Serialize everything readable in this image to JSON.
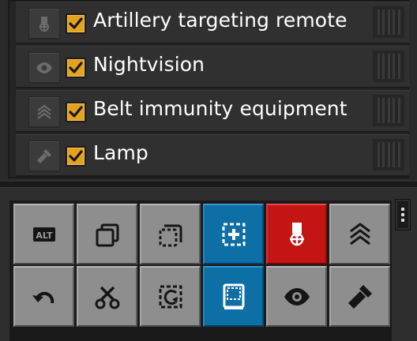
{
  "equipment_list": [
    {
      "label": "Artillery targeting remote",
      "icon": "artillery-remote-icon",
      "checked": true
    },
    {
      "label": "Nightvision",
      "icon": "eye-icon",
      "checked": true
    },
    {
      "label": "Belt immunity equipment",
      "icon": "belt-immunity-icon",
      "checked": true
    },
    {
      "label": "Lamp",
      "icon": "flashlight-icon",
      "checked": true
    }
  ],
  "toolbar": {
    "row1": [
      {
        "icon": "alt-mode-icon",
        "label": "ALT",
        "state": "normal"
      },
      {
        "icon": "copy-icon",
        "state": "normal"
      },
      {
        "icon": "cut-selection-icon",
        "state": "normal"
      },
      {
        "icon": "paste-blueprint-icon",
        "state": "active-blue"
      },
      {
        "icon": "artillery-remote-icon",
        "state": "active-red"
      },
      {
        "icon": "belt-immunity-icon",
        "state": "normal"
      }
    ],
    "row2": [
      {
        "icon": "undo-icon",
        "state": "normal"
      },
      {
        "icon": "scissors-icon",
        "state": "normal"
      },
      {
        "icon": "deconstruct-icon",
        "state": "normal"
      },
      {
        "icon": "blueprint-book-icon",
        "state": "active-blue"
      },
      {
        "icon": "eye-icon",
        "state": "normal"
      },
      {
        "icon": "flashlight-icon",
        "state": "normal"
      }
    ]
  },
  "colors": {
    "checkbox": "#e4a221",
    "active_blue": "#0e6ea6",
    "active_red": "#c41414",
    "button_gray": "#8e8e8e"
  }
}
